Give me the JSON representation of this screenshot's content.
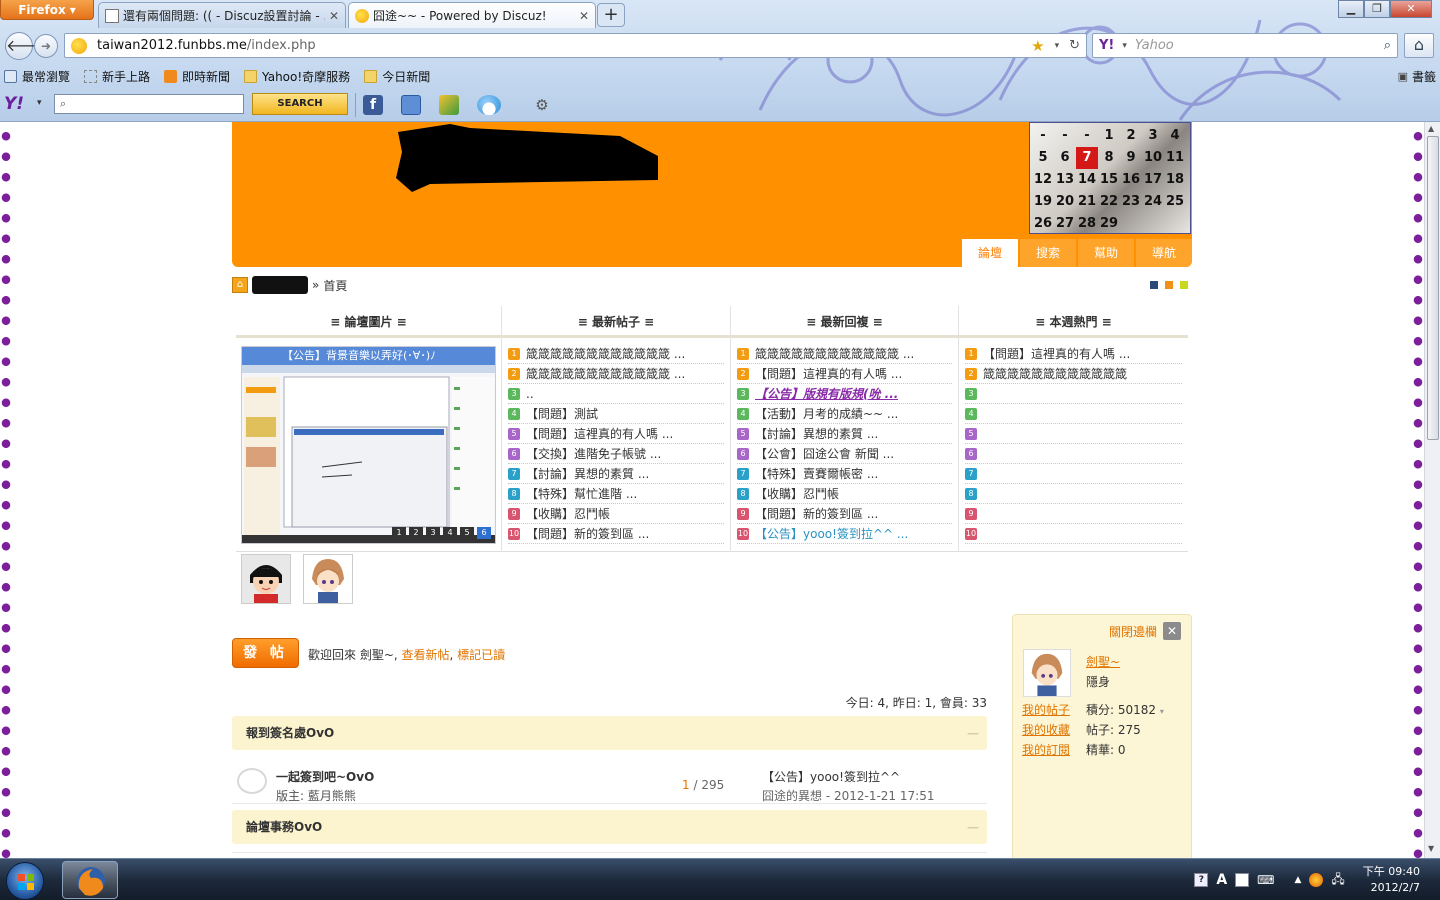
{
  "browser": {
    "firefox_button": "Firefox",
    "tabs": [
      {
        "label": "還有兩個問題: (( - Discuz設置討論 - ..."
      },
      {
        "label": "囧途~~ - Powered by Discuz!"
      }
    ],
    "url_host": "taiwan2012.funbbs.me",
    "url_path": "/index.php",
    "search_engine": "Y!",
    "search_placeholder": "Yahoo",
    "bookmarks": [
      "最常瀏覽",
      "新手上路",
      "即時新聞",
      "Yahoo!奇摩服務",
      "今日新聞"
    ],
    "bookmarks_right": "書籤",
    "yahoo_toolbar": {
      "logo": "Y!",
      "search_button": "SEARCH"
    }
  },
  "banner": {
    "calendar": [
      "-",
      "-",
      "-",
      "1",
      "2",
      "3",
      "4",
      "5",
      "6",
      "7",
      "8",
      "9",
      "10",
      "11",
      "12",
      "13",
      "14",
      "15",
      "16",
      "17",
      "18",
      "19",
      "20",
      "21",
      "22",
      "23",
      "24",
      "25",
      "26",
      "27",
      "28",
      "29"
    ],
    "calendar_today": "7",
    "nav": [
      "論壇",
      "搜索",
      "幫助",
      "導航"
    ]
  },
  "breadcrumb": {
    "current": "首頁",
    "separator": "»"
  },
  "portal": {
    "columns": [
      {
        "title": "≡ 論壇圖片 ≡"
      },
      {
        "title": "≡ 最新帖子 ≡",
        "items": [
          {
            "text": "箴箴箴箴箴箴箴箴箴箴箴箴 ...",
            "style": ""
          },
          {
            "text": "箴箴箴箴箴箴箴箴箴箴箴箴 ...",
            "style": ""
          },
          {
            "text": "..",
            "style": ""
          },
          {
            "text": "【問題】測試",
            "style": ""
          },
          {
            "text": "【問題】這裡真的有人嗎 ...",
            "style": ""
          },
          {
            "text": "【交換】進階免子帳號 ...",
            "style": ""
          },
          {
            "text": "【討論】異想的素質 ...",
            "style": ""
          },
          {
            "text": "【特殊】幫忙進階 ...",
            "style": ""
          },
          {
            "text": "【收購】忍鬥帳",
            "style": ""
          },
          {
            "text": "【問題】新的簽到區 ...",
            "style": ""
          }
        ]
      },
      {
        "title": "≡ 最新回複 ≡",
        "items": [
          {
            "text": "箴箴箴箴箴箴箴箴箴箴箴箴 ...",
            "style": ""
          },
          {
            "text": "【問題】這裡真的有人嗎 ...",
            "style": ""
          },
          {
            "text": "【公告】版規有版規(吮 ...",
            "style": "hl-purple"
          },
          {
            "text": "【活動】月考的成績~~ ...",
            "style": ""
          },
          {
            "text": "【討論】異想的素質 ...",
            "style": ""
          },
          {
            "text": "【公會】囧途公會 新聞 ...",
            "style": ""
          },
          {
            "text": "【特殊】賣賽爾帳密 ...",
            "style": ""
          },
          {
            "text": "【收購】忍鬥帳",
            "style": ""
          },
          {
            "text": "【問題】新的簽到區 ...",
            "style": ""
          },
          {
            "text": "【公告】yooo!簽到拉^^ ...",
            "style": "hl-blue"
          }
        ]
      },
      {
        "title": "≡ 本週熱門 ≡",
        "items": [
          {
            "text": "【問題】這裡真的有人嗎 ...",
            "style": ""
          },
          {
            "text": "箴箴箴箴箴箴箴箴箴箴箴箴",
            "style": ""
          },
          {
            "text": "",
            "style": ""
          },
          {
            "text": "",
            "style": ""
          },
          {
            "text": "",
            "style": ""
          },
          {
            "text": "",
            "style": ""
          },
          {
            "text": "",
            "style": ""
          },
          {
            "text": "",
            "style": ""
          },
          {
            "text": "",
            "style": ""
          },
          {
            "text": "",
            "style": ""
          }
        ]
      }
    ],
    "rank_colors": [
      "#f39c12",
      "#f39c12",
      "#5cb85c",
      "#5cb85c",
      "#a866c8",
      "#a866c8",
      "#2aa1c9",
      "#2aa1c9",
      "#d9546e",
      "#d9546e"
    ],
    "pic_caption": "【公告】背景音樂以弄好(･∀･)ﾉ",
    "pic_pager": [
      "1",
      "2",
      "3",
      "4",
      "5",
      "6"
    ]
  },
  "actions": {
    "post_button": "發 帖",
    "welcome_prefix": "歡迎回來 劍聖~,",
    "new_posts_link": "查看新帖",
    "mark_read_link": "標記已讀"
  },
  "stats": "今日: 4, 昨日: 1, 會員: 33",
  "categories": [
    {
      "title": "報到簽名處OvO"
    },
    {
      "title": "論壇事務OvO"
    }
  ],
  "forum": {
    "name": "一起簽到吧~OvO",
    "moderator": "版主: 藍月熊熊",
    "threads": "1",
    "posts": " / 295",
    "last_title": "【公告】yooo!簽到拉^^",
    "last_meta": "囧途的異想 - 2012-1-21 17:51"
  },
  "user_panel": {
    "close_label": "關閉邊欄",
    "close_x": "✕",
    "name": "劍聖~",
    "status": "隱身",
    "links": [
      "我的帖子",
      "我的收藏",
      "我的訂閱"
    ],
    "stats": [
      "積分: 50182",
      "帖子: 275",
      "精華: 0"
    ]
  },
  "taskbar": {
    "clock_time": "下午 09:40",
    "clock_date": "2012/2/7"
  }
}
